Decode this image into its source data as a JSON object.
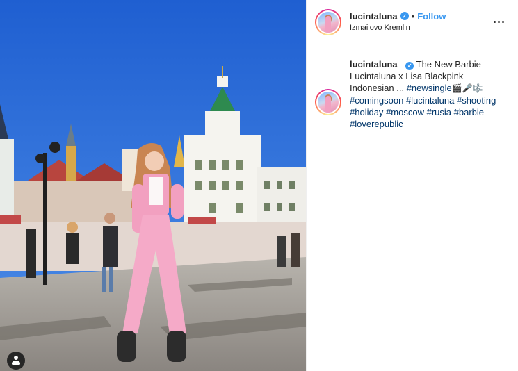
{
  "post": {
    "username": "lucintaluna",
    "verified_icon": "verified-badge-icon",
    "separator": "•",
    "follow_label": "Follow",
    "location": "Izmailovo Kremlin",
    "more_icon": "more-options-icon"
  },
  "caption": {
    "username": "lucintaluna",
    "text_line1": "The New Barbie",
    "text_line2": "Lucintaluna x Lisa Blackpink",
    "text_line3": "Indonesian ...",
    "emojis": "🎬🎤🎼",
    "hashtags": [
      "#newsingle",
      "#comingsoon",
      "#lucintaluna",
      "#shooting",
      "#holiday",
      "#moscow",
      "#rusia",
      "#barbie",
      "#loverepublic"
    ]
  },
  "photo": {
    "tag_icon": "user-tag-icon"
  },
  "colors": {
    "link": "#3897f0",
    "hashtag": "#003569",
    "sky": "#2a6bd6",
    "outfit": "#f2a0c0"
  }
}
